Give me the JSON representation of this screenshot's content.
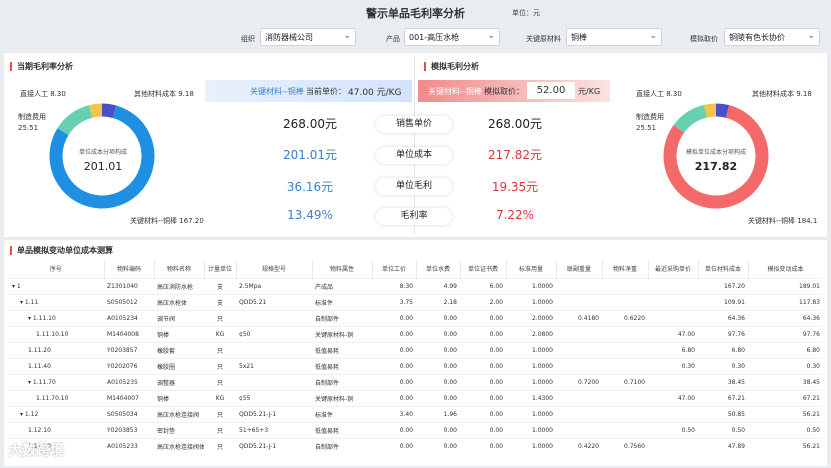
{
  "header": {
    "title": "警示单品毛利率分析",
    "unit": "单位：元"
  },
  "filters": {
    "org_label": "组织",
    "org_value": "消防器械公司",
    "product_label": "产品",
    "product_value": "001-高压水枪",
    "material_label": "关键原材料",
    "material_value": "铜棒",
    "price_label": "模拟取价",
    "price_value": "铜陵有色长协价"
  },
  "current": {
    "title": "当期毛利率分析",
    "banner_material": "关键材料--铜棒",
    "banner_price_label": "当前单价：",
    "banner_price_value": "47.00 元/KG",
    "donut_center_label": "单位成本分项构成",
    "donut_center_value": "201.01",
    "labels": {
      "labor": "直接人工  8.30",
      "other": "其他材料成本  9.18",
      "mfg_name": "制造费用",
      "mfg_value": "25.51",
      "key": "关键材料--铜棒  167.20"
    }
  },
  "simulated": {
    "title": "模拟毛利分析",
    "banner_material": "关键材料--铜棒",
    "banner_price_label": "模拟取价：",
    "banner_price_value": "52.00",
    "banner_price_unit": "元/KG",
    "donut_center_label": "模拟单位成本分项构成",
    "donut_center_value": "217.82",
    "labels": {
      "labor": "直接人工  8.30",
      "other": "其他材料成本  9.18",
      "mfg_name": "制造费用",
      "mfg_value": "25.51",
      "key": "关键材料--铜棒  184.1"
    }
  },
  "compare": {
    "rows": [
      {
        "label": "销售单价",
        "current": "268.00元",
        "simulated": "268.00元"
      },
      {
        "label": "单位成本",
        "current": "201.01元",
        "simulated": "217.82元"
      },
      {
        "label": "单位毛利",
        "current": "36.16元",
        "simulated": "19.35元"
      },
      {
        "label": "毛利率",
        "current": "13.49%",
        "simulated": "7.22%"
      }
    ]
  },
  "colors": {
    "blue": "#1e8fe1",
    "red": "#f46a6a",
    "green": "#67d0b0",
    "yellow": "#f3c34a",
    "purple": "#4b4fc4",
    "accent_red": "#e24c4c"
  },
  "chart_data": [
    {
      "type": "pie",
      "title": "单位成本分项构成",
      "total": "201.01",
      "categories": [
        "关键材料--铜棒",
        "制造费用",
        "直接人工",
        "其他材料成本"
      ],
      "values": [
        167.2,
        25.51,
        8.3,
        9.18
      ]
    },
    {
      "type": "pie",
      "title": "模拟单位成本分项构成",
      "total": "217.82",
      "categories": [
        "关键材料--铜棒",
        "制造费用",
        "直接人工",
        "其他材料成本"
      ],
      "values": [
        184.1,
        25.51,
        8.3,
        9.18
      ]
    }
  ],
  "table": {
    "title": "单品模拟变动单位成本测算",
    "columns": [
      "序号",
      "物料编码",
      "物料名称",
      "计量单位",
      "规格型号",
      "物料属性",
      "单位工价",
      "单位水费",
      "单位证书费",
      "标准用量",
      "联副重量",
      "物料净重",
      "最近采购单价",
      "单位材料成本",
      "模拟变动成本"
    ],
    "rows": [
      [
        "▾ 1",
        "Z1301040",
        "高压消防水枪",
        "支",
        "2.5Mpa",
        "产成品",
        "8.30",
        "4.99",
        "6.00",
        "1.0000",
        "",
        "",
        "",
        "167.20",
        "189.01"
      ],
      [
        "▾ 1.11",
        "S0505012",
        "高压水枪体",
        "支",
        "QDD5.21",
        "标准件",
        "3.75",
        "2.18",
        "2.00",
        "1.0000",
        "",
        "",
        "",
        "109.91",
        "117.83"
      ],
      [
        "▾ 1.11.10",
        "A0105234",
        "调节阀",
        "只",
        "",
        "自制部件",
        "0.00",
        "0.00",
        "0.00",
        "2.0000",
        "0.4180",
        "0.6220",
        "",
        "64.36",
        "64.36"
      ],
      [
        "1.11.10.10",
        "M1404008",
        "铜棒",
        "KG",
        "¢50",
        "关键原材料-铜",
        "0.00",
        "0.00",
        "0.00",
        "2.0800",
        "",
        "",
        "47.00",
        "97.76",
        "97.76"
      ],
      [
        "1.11.20",
        "Y0203857",
        "橡胶套",
        "只",
        "",
        "低值易耗",
        "0.00",
        "0.00",
        "0.00",
        "1.0000",
        "",
        "",
        "6.80",
        "6.80",
        "6.80"
      ],
      [
        "1.11.40",
        "Y0202076",
        "橡胶圈",
        "只",
        "5x21",
        "低值易耗",
        "0.00",
        "0.00",
        "0.00",
        "1.0000",
        "",
        "",
        "0.30",
        "0.30",
        "0.30"
      ],
      [
        "▾ 1.11.70",
        "A0105235",
        "调整器",
        "只",
        "",
        "自制部件",
        "0.00",
        "0.00",
        "0.00",
        "1.0000",
        "0.7200",
        "0.7100",
        "",
        "38.45",
        "38.45"
      ],
      [
        "1.11.70.10",
        "M1404007",
        "铜棒",
        "KG",
        "¢55",
        "关键原材料-铜",
        "0.00",
        "0.00",
        "0.00",
        "1.4300",
        "",
        "",
        "47.00",
        "67.21",
        "67.21"
      ],
      [
        "▾ 1.12",
        "S0505034",
        "高压水枪连接阀",
        "只",
        "QDD5.21-J-1",
        "标准件",
        "3.40",
        "1.96",
        "0.00",
        "1.0000",
        "",
        "",
        "",
        "50.85",
        "56.21"
      ],
      [
        "1.12.10",
        "Y0203853",
        "密封垫",
        "只",
        "51+65+3",
        "低值易耗",
        "0.00",
        "0.00",
        "0.00",
        "1.0000",
        "",
        "",
        "0.50",
        "0.50",
        "0.50"
      ],
      [
        "1.12.20",
        "A0105233",
        "高压水枪连接阀体",
        "只",
        "QDD5.21-J-1",
        "自制部件",
        "0.00",
        "0.00",
        "0.00",
        "1.0000",
        "0.4220",
        "0.7560",
        "",
        "47.89",
        "56.21"
      ]
    ]
  },
  "watermark": "大数跨境"
}
